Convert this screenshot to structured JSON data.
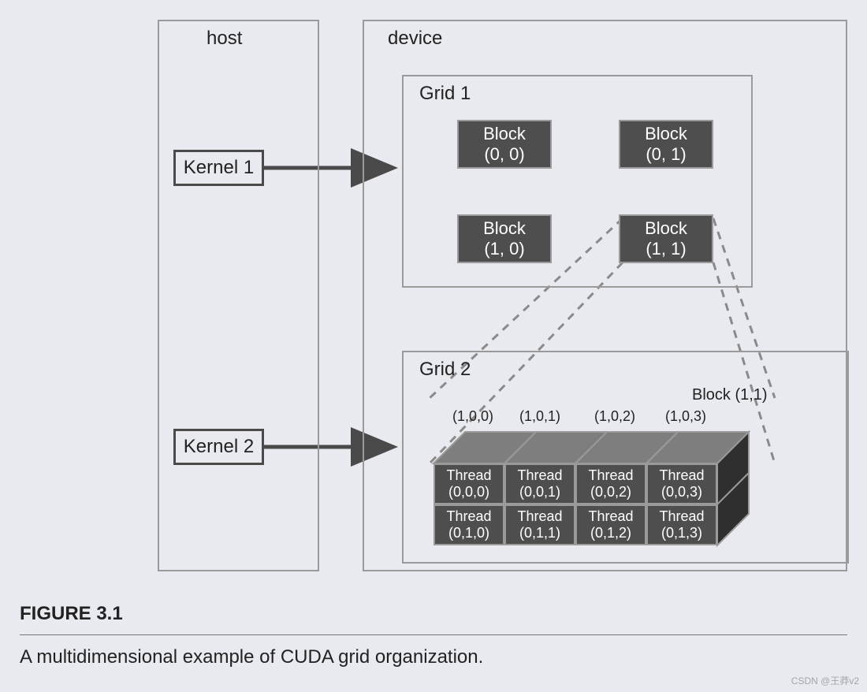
{
  "host": {
    "label": "host"
  },
  "device": {
    "label": "device"
  },
  "kernels": [
    {
      "label": "Kernel 1"
    },
    {
      "label": "Kernel 2"
    }
  ],
  "grid1": {
    "label": "Grid 1",
    "blocks": [
      {
        "title": "Block",
        "coord": "(0, 0)"
      },
      {
        "title": "Block",
        "coord": "(0, 1)"
      },
      {
        "title": "Block",
        "coord": "(1, 0)"
      },
      {
        "title": "Block",
        "coord": "(1, 1)"
      }
    ]
  },
  "grid2": {
    "label": "Grid 2",
    "block_label": "Block (1,1)",
    "top_coords": [
      "(1,0,0)",
      "(1,0,1)",
      "(1,0,2)",
      "(1,0,3)"
    ],
    "threads_row0": [
      {
        "title": "Thread",
        "coord": "(0,0,0)"
      },
      {
        "title": "Thread",
        "coord": "(0,0,1)"
      },
      {
        "title": "Thread",
        "coord": "(0,0,2)"
      },
      {
        "title": "Thread",
        "coord": "(0,0,3)"
      }
    ],
    "threads_row1": [
      {
        "title": "Thread",
        "coord": "(0,1,0)"
      },
      {
        "title": "Thread",
        "coord": "(0,1,1)"
      },
      {
        "title": "Thread",
        "coord": "(0,1,2)"
      },
      {
        "title": "Thread",
        "coord": "(0,1,3)"
      }
    ]
  },
  "figure": {
    "number": "FIGURE 3.1",
    "caption": "A multidimensional example of CUDA grid organization."
  },
  "watermark": "CSDN @王莽v2"
}
